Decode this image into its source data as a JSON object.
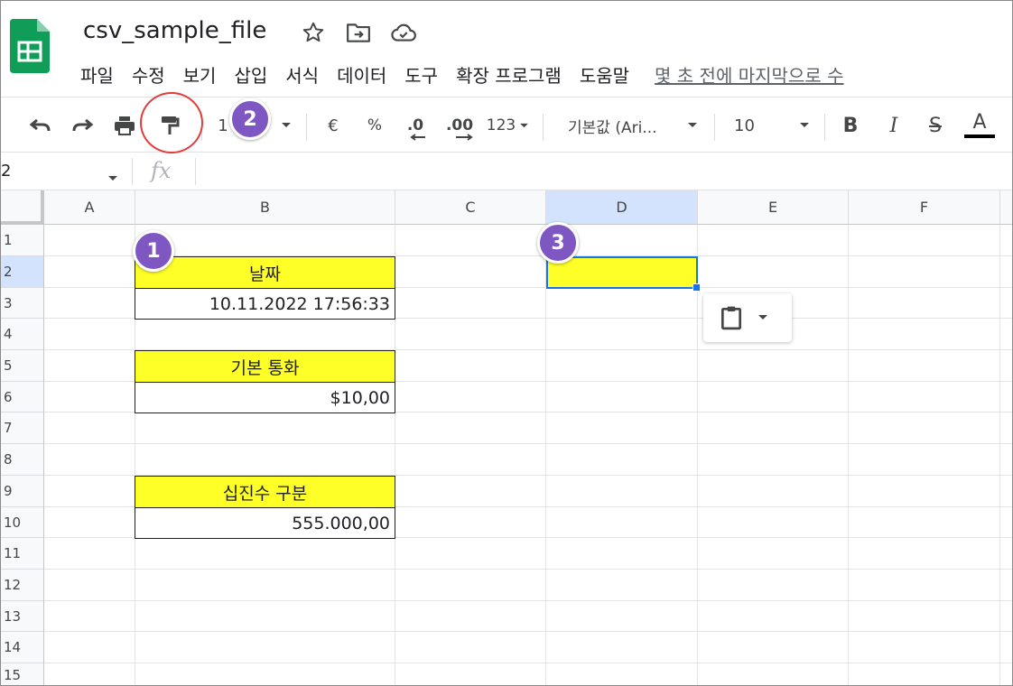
{
  "document": {
    "title": "csv_sample_file"
  },
  "menu": {
    "items": [
      "파일",
      "수정",
      "보기",
      "삽입",
      "서식",
      "데이터",
      "도구",
      "확장 프로그램",
      "도움말"
    ],
    "last_edit": "몇 초 전에 마지막으로 수"
  },
  "toolbar": {
    "zoom": "1",
    "currency": "€",
    "percent": "%",
    "decrease_decimal": ".0",
    "increase_decimal": ".00",
    "more_formats": "123",
    "font": "기본값 (Ari...",
    "font_size": "10",
    "bold": "B",
    "italic": "I",
    "strike": "S",
    "text_color": "A"
  },
  "formula_bar": {
    "name_box": "2",
    "fx": "fx"
  },
  "columns": [
    "A",
    "B",
    "C",
    "D",
    "E",
    "F"
  ],
  "rows": [
    "1",
    "2",
    "3",
    "4",
    "5",
    "6",
    "7",
    "8",
    "9",
    "10",
    "11",
    "12",
    "13",
    "14",
    "15"
  ],
  "cells": {
    "b2": "날짜",
    "b3": "10.11.2022 17:56:33",
    "b5": "기본 통화",
    "b6": "$10,00",
    "b9": "십진수 구분",
    "b10": "555.000,00"
  },
  "annotations": {
    "step1": "1",
    "step2": "2",
    "step3": "3"
  },
  "colors": {
    "highlight_fill": "#ffff28",
    "selection": "#1a73e8",
    "badge": "#7e57c2",
    "ring": "#e23b3b"
  }
}
